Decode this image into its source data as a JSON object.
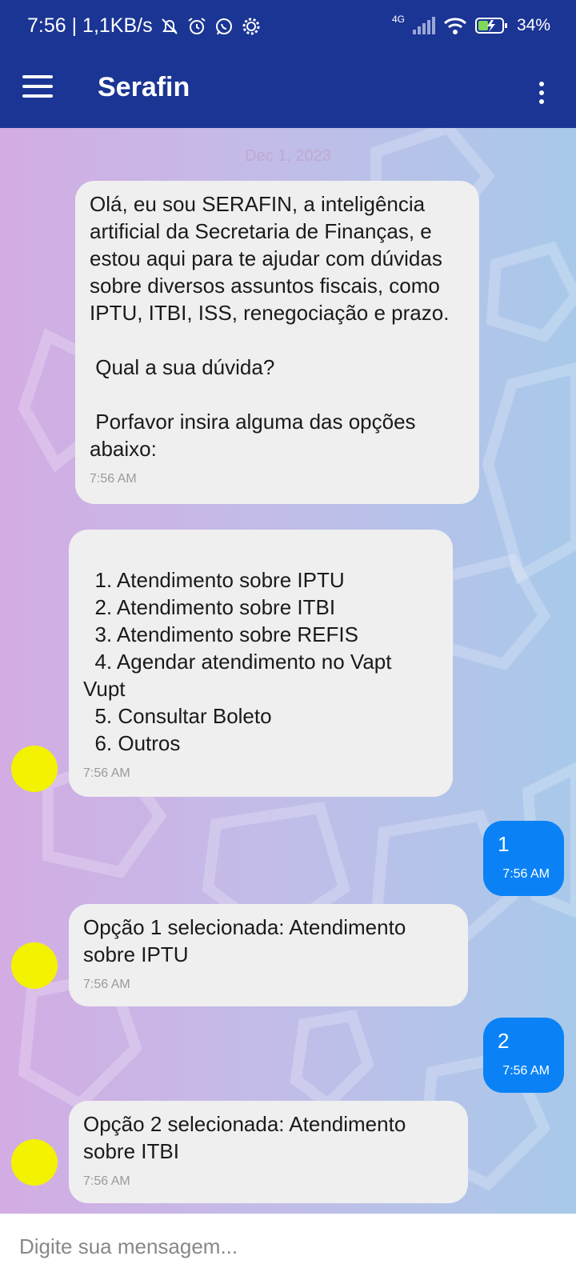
{
  "status_bar": {
    "time_speed": "7:56 | 1,1KB/s",
    "network": "4G",
    "battery": "34%"
  },
  "app_bar": {
    "title": "Serafin"
  },
  "chat": {
    "date": "Dec 1, 2023",
    "messages": [
      {
        "from": "bot",
        "text": "Olá, eu sou SERAFIN, a inteligência artificial da Secretaria de Finanças, e estou aqui para te ajudar com dúvidas sobre diversos assuntos fiscais, como IPTU, ITBI, ISS, renegociação e prazo.\n\n Qual a sua dúvida?\n\n Porfavor insira alguma das opções abaixo:",
        "time": "7:56 AM"
      },
      {
        "from": "bot",
        "text": "\n  1. Atendimento sobre IPTU\n  2. Atendimento sobre ITBI\n  3. Atendimento sobre REFIS\n  4. Agendar atendimento no Vapt Vupt\n  5. Consultar Boleto\n  6. Outros",
        "time": "7:56 AM"
      },
      {
        "from": "user",
        "text": "1",
        "time": "7:56 AM"
      },
      {
        "from": "bot",
        "text": "Opção 1 selecionada: Atendimento sobre IPTU",
        "time": "7:56 AM"
      },
      {
        "from": "user",
        "text": "2",
        "time": "7:56 AM"
      },
      {
        "from": "bot",
        "text": "Opção 2 selecionada: Atendimento sobre ITBI",
        "time": "7:56 AM"
      }
    ]
  },
  "input": {
    "placeholder": "Digite sua mensagem..."
  },
  "colors": {
    "app_bar": "#1b3594",
    "user_bubble": "#0a82f6",
    "bot_bubble": "#efefef",
    "avatar": "#f3f200"
  }
}
